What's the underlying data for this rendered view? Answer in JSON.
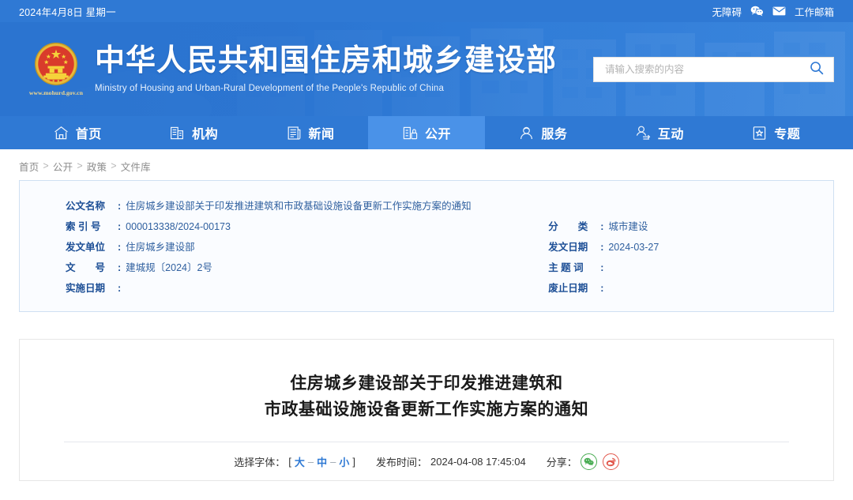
{
  "topbar": {
    "date": "2024年4月8日 星期一",
    "accessibility_label": "无障碍",
    "wechat_icon": "wechat-icon",
    "mail_icon": "mail-icon",
    "mail_label": "工作邮箱"
  },
  "masthead": {
    "emblem_icon": "national-emblem-icon",
    "site_url": "www.mohurd.gov.cn",
    "cn_title": "中华人民共和国住房和城乡建设部",
    "en_title": "Ministry of Housing and Urban-Rural Development of the People's Republic of China",
    "search": {
      "placeholder": "请输入搜索的内容",
      "value": "",
      "icon": "search-icon"
    }
  },
  "nav": {
    "items": [
      {
        "label": "首页",
        "icon": "home-icon",
        "active": false
      },
      {
        "label": "机构",
        "icon": "building-icon",
        "active": false
      },
      {
        "label": "新闻",
        "icon": "news-icon",
        "active": false
      },
      {
        "label": "公开",
        "icon": "open-info-icon",
        "active": true
      },
      {
        "label": "服务",
        "icon": "service-person-icon",
        "active": false
      },
      {
        "label": "互动",
        "icon": "interaction-icon",
        "active": false
      },
      {
        "label": "专题",
        "icon": "star-document-icon",
        "active": false
      }
    ]
  },
  "breadcrumb": {
    "items": [
      "首页",
      "公开",
      "政策",
      "文件库"
    ],
    "separator": ">"
  },
  "meta": {
    "left": [
      {
        "label": "公文名称",
        "label_style": "normal",
        "value": "住房城乡建设部关于印发推进建筑和市政基础设施设备更新工作实施方案的通知"
      },
      {
        "label": "索 引 号",
        "label_style": "normal",
        "value": "000013338/2024-00173"
      },
      {
        "label": "发文单位",
        "label_style": "normal",
        "value": "住房城乡建设部"
      },
      {
        "label": "文",
        "label_style": "spread2",
        "value": "建城规〔2024〕2号"
      },
      {
        "label": "实施日期",
        "label_style": "normal",
        "value": ""
      }
    ],
    "right": [
      {
        "label": "分",
        "label_style": "spread2",
        "value": "城市建设"
      },
      {
        "label": "发文日期",
        "label_style": "normal",
        "value": "2024-03-27"
      },
      {
        "label": "主 题 词",
        "label_style": "normal",
        "value": ""
      },
      {
        "label": "废止日期",
        "label_style": "normal",
        "value": ""
      }
    ],
    "right_labels_full": [
      "分　　类",
      "发文日期",
      "主 题 词",
      "废止日期"
    ],
    "left_labels_full": [
      "公文名称",
      "索 引 号",
      "发文单位",
      "文　　号",
      "实施日期"
    ]
  },
  "article": {
    "title_line1": "住房城乡建设部关于印发推进建筑和",
    "title_line2": "市政基础设施设备更新工作实施方案的通知",
    "font_label": "选择字体：",
    "bracket_open": "[",
    "bracket_close": "]",
    "font_large": "大",
    "font_medium": "中",
    "font_small": "小",
    "dash": "–",
    "publish_label": "发布时间：",
    "publish_time": "2024-04-08 17:45:04",
    "share_label": "分享：",
    "share_wechat_icon": "wechat-share-icon",
    "share_weibo_icon": "weibo-share-icon"
  },
  "colors": {
    "brand_blue": "#2f79d4",
    "nav_active": "#4a92e8",
    "meta_border": "#cfe0f2",
    "meta_bg": "#fafcff",
    "link_blue": "#2f79d4",
    "wechat_green": "#4aad54",
    "weibo_red": "#e2574c"
  }
}
